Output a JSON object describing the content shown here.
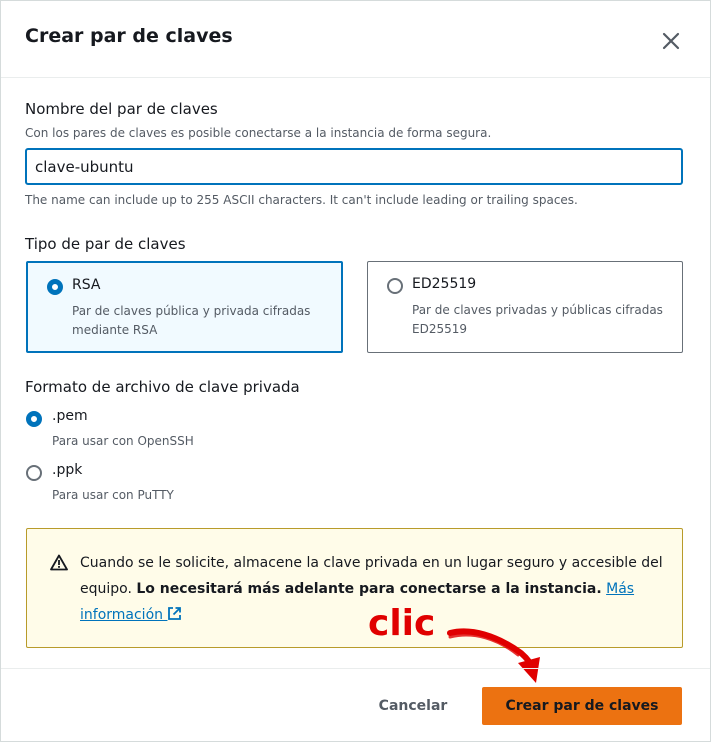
{
  "dialog": {
    "title": "Crear par de claves"
  },
  "name_field": {
    "label": "Nombre del par de claves",
    "description": "Con los pares de claves es posible conectarse a la instancia de forma segura.",
    "value": "clave-ubuntu",
    "constraint": "The name can include up to 255 ASCII characters. It can't include leading or trailing spaces."
  },
  "key_type": {
    "label": "Tipo de par de claves",
    "options": [
      {
        "title": "RSA",
        "description": "Par de claves pública y privada cifradas mediante RSA",
        "selected": true
      },
      {
        "title": "ED25519",
        "description": "Par de claves privadas y públicas cifradas ED25519",
        "selected": false
      }
    ]
  },
  "file_format": {
    "label": "Formato de archivo de clave privada",
    "options": [
      {
        "title": ".pem",
        "description": "Para usar con OpenSSH",
        "selected": true
      },
      {
        "title": ".ppk",
        "description": "Para usar con PuTTY",
        "selected": false
      }
    ]
  },
  "alert": {
    "text": "Cuando se le solicite, almacene la clave privada en un lugar seguro y accesible del equipo.",
    "bold_text": "Lo necesitará más adelante para conectarse a la instancia.",
    "link_text": "Más información"
  },
  "footer": {
    "cancel_label": "Cancelar",
    "create_label": "Crear par de claves"
  },
  "annotation": {
    "text": "clic",
    "color": "#e00000"
  },
  "colors": {
    "accent": "#0073bb",
    "primary_button": "#ec7211",
    "warning_border": "#b89b2a",
    "warning_bg": "#fffce9"
  },
  "icons": {
    "close": "close-icon",
    "warning": "warning-icon",
    "external": "external-link-icon"
  }
}
